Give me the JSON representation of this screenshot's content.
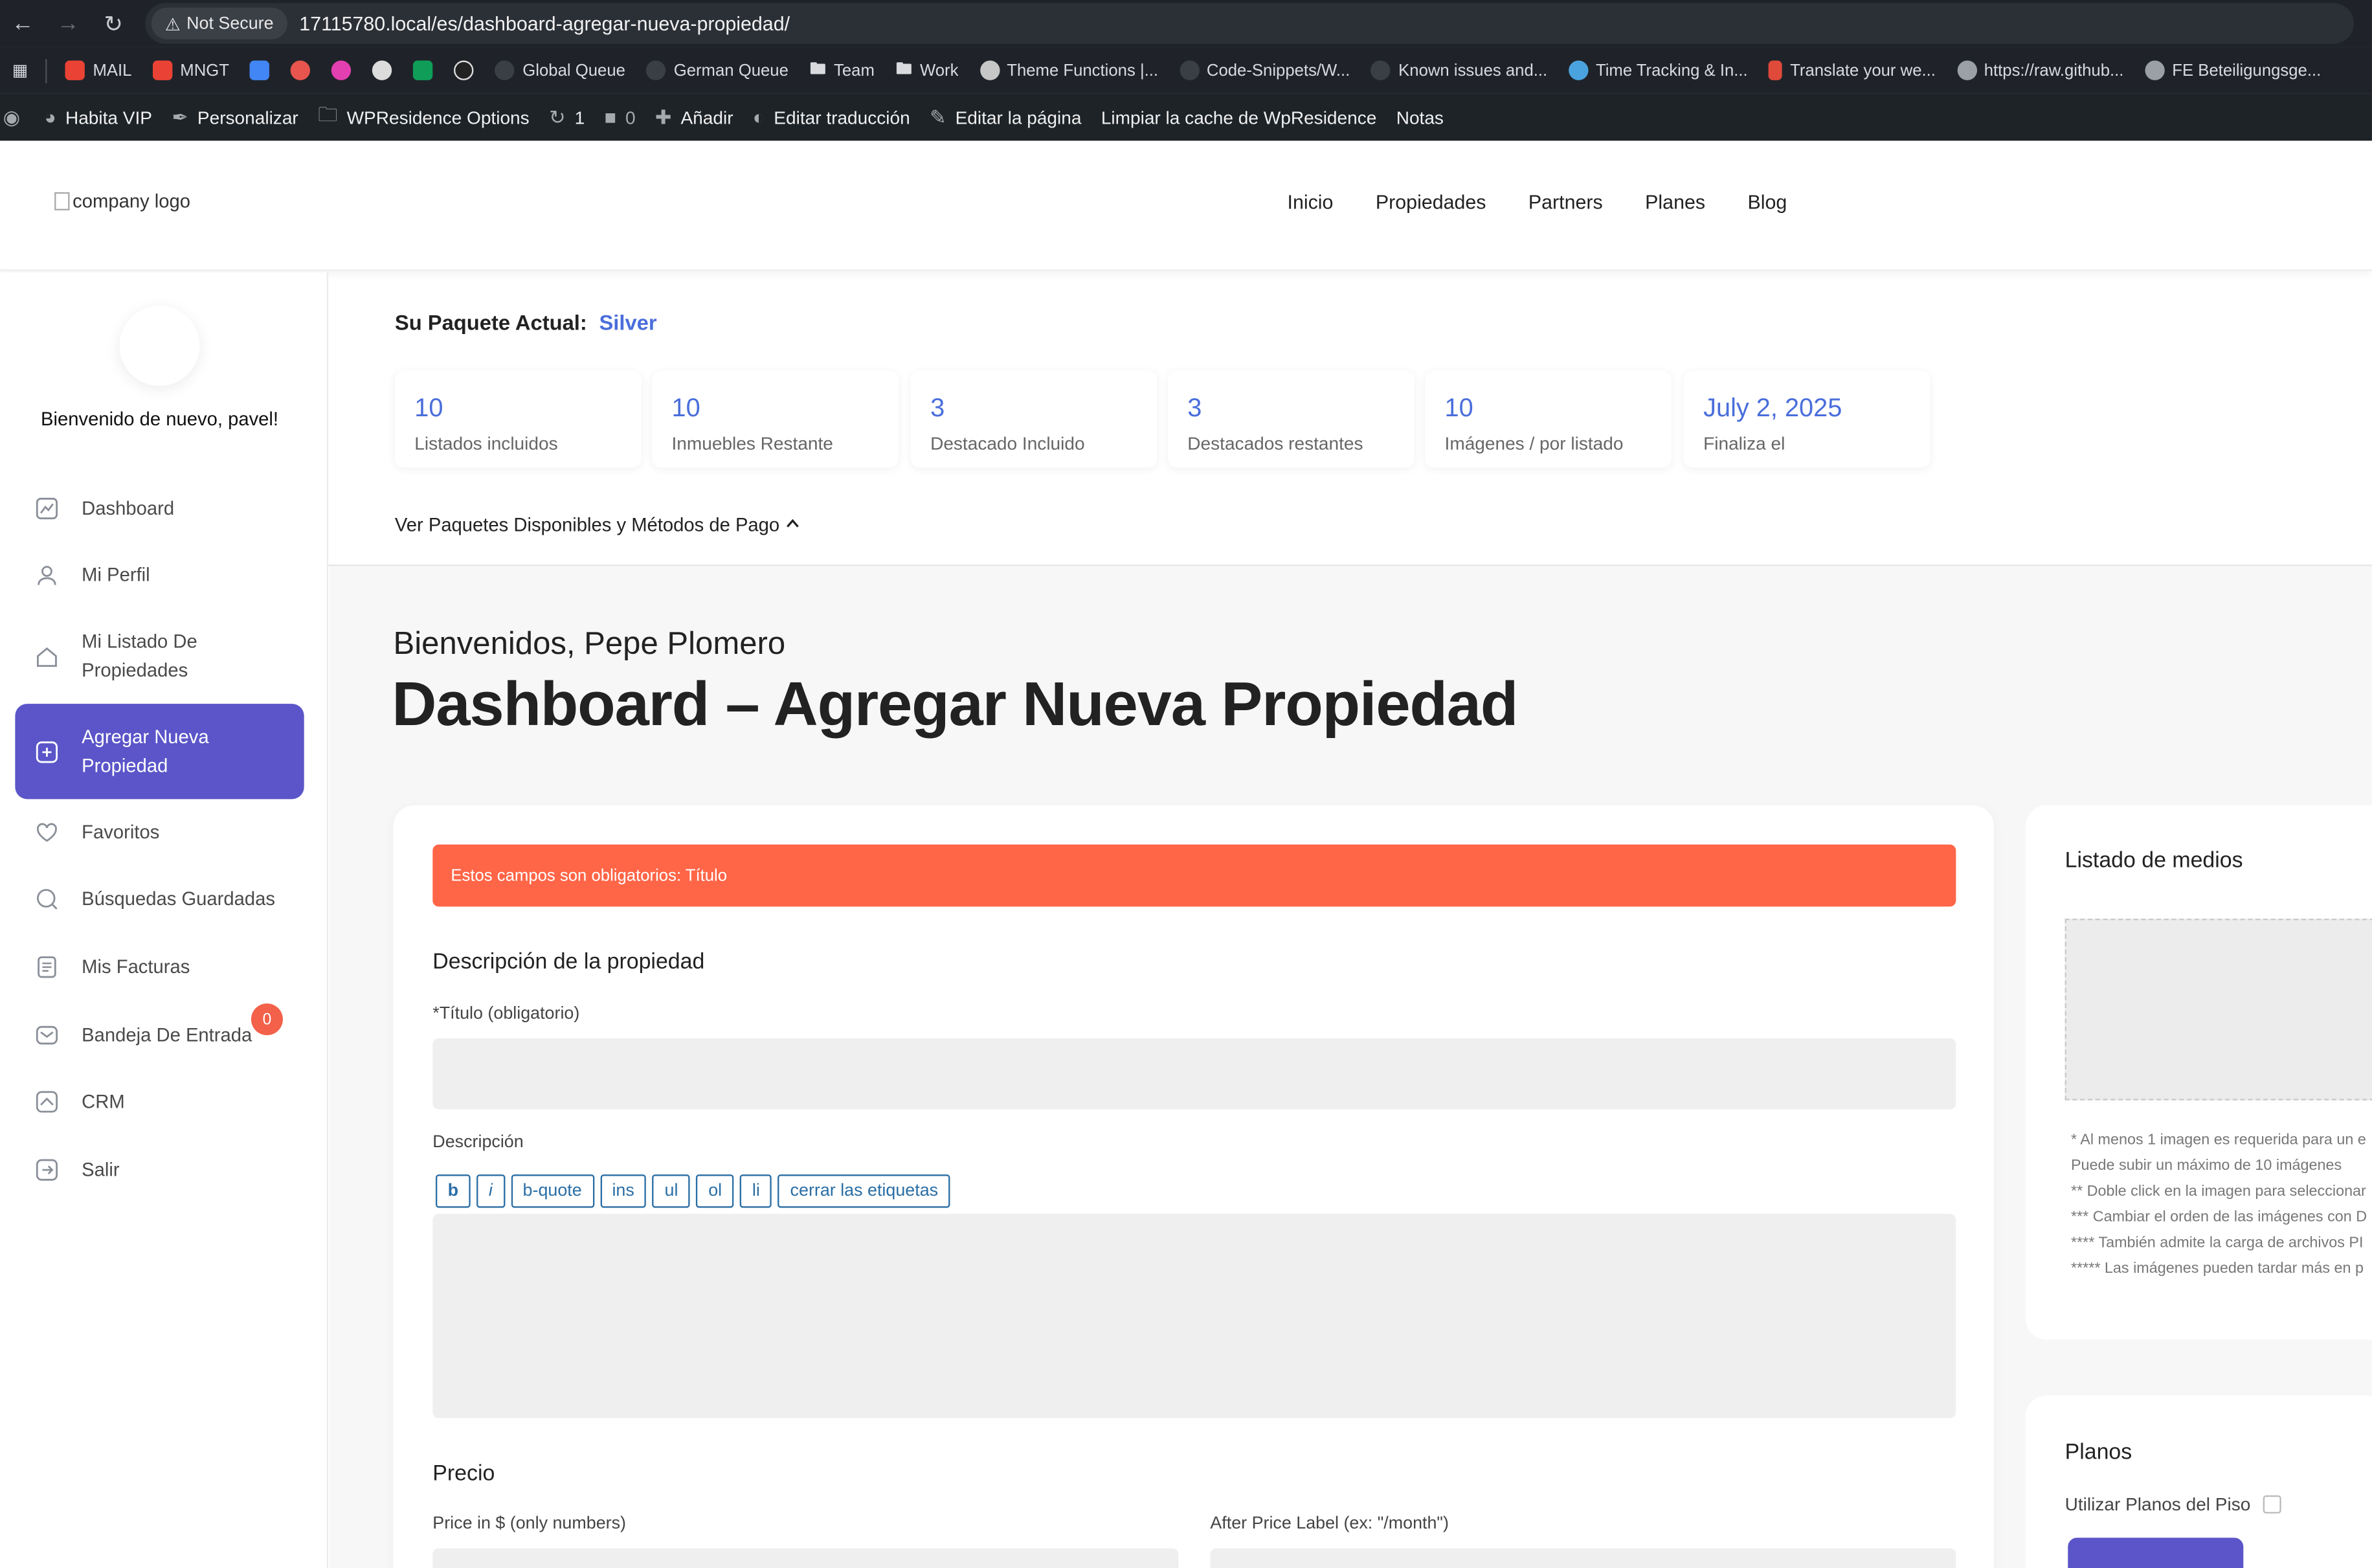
{
  "browser": {
    "security_label": "Not Secure",
    "url": "17115780.local/es/dashboard-agregar-nueva-propiedad/",
    "bookmarks": [
      "MAIL",
      "MNGT",
      "Global Queue",
      "German Queue",
      "Team",
      "Work",
      "Theme Functions |...",
      "Code-Snippets/W...",
      "Known issues and...",
      "Time Tracking & In...",
      "Translate your we...",
      "https://raw.github...",
      "FE Beteiligungsge..."
    ]
  },
  "adminbar": {
    "site": "Habita VIP",
    "customize": "Personalizar",
    "options": "WPResidence Options",
    "updates": "1",
    "comments": "0",
    "add": "Añadir",
    "edit_translation": "Editar traducción",
    "edit_page": "Editar la página",
    "clear_cache": "Limpiar la cache de WpResidence",
    "notes": "Notas"
  },
  "header": {
    "logo_alt": "company logo",
    "nav": [
      "Inicio",
      "Propiedades",
      "Partners",
      "Planes",
      "Blog"
    ]
  },
  "sidebar": {
    "welcome": "Bienvenido de nuevo, pavel!",
    "items": [
      {
        "label": "Dashboard",
        "icon": "chart-icon"
      },
      {
        "label": "Mi Perfil",
        "icon": "user-icon"
      },
      {
        "label": "Mi Listado De Propiedades",
        "icon": "home-icon"
      },
      {
        "label": "Agregar Nueva Propiedad",
        "icon": "plus-square-icon"
      },
      {
        "label": "Favoritos",
        "icon": "heart-icon"
      },
      {
        "label": "Búsquedas Guardadas",
        "icon": "search-icon"
      },
      {
        "label": "Mis Facturas",
        "icon": "invoice-icon"
      },
      {
        "label": "Bandeja De Entrada",
        "icon": "mail-icon",
        "badge": "0"
      },
      {
        "label": "CRM",
        "icon": "crm-icon"
      },
      {
        "label": "Salir",
        "icon": "logout-icon"
      }
    ]
  },
  "package": {
    "title": "Su Paquete Actual:",
    "name": "Silver",
    "stats": [
      {
        "value": "10",
        "label": "Listados incluidos"
      },
      {
        "value": "10",
        "label": "Inmuebles Restante"
      },
      {
        "value": "3",
        "label": "Destacado Incluido"
      },
      {
        "value": "3",
        "label": "Destacados restantes"
      },
      {
        "value": "10",
        "label": "Imágenes / por listado"
      },
      {
        "value": "July 2, 2025",
        "label": "Finaliza el"
      }
    ],
    "toggle": "Ver Paquetes Disponibles y Métodos de Pago"
  },
  "main": {
    "welcome": "Bienvenidos, Pepe Plomero",
    "title": "Dashboard – Agregar Nueva Propiedad"
  },
  "form": {
    "alert": "Estos campos son obligatorios: Título",
    "section_description": "Descripción de la propiedad",
    "title_label": "*Título (obligatorio)",
    "description_label": "Descripción",
    "quicktags": [
      "b",
      "i",
      "b-quote",
      "ins",
      "ul",
      "ol",
      "li",
      "cerrar las etiquetas"
    ],
    "section_price": "Precio",
    "price_label": "Price in $ (only numbers)",
    "after_price_label": "After Price Label (ex: \"/month\")"
  },
  "media": {
    "title": "Listado de medios",
    "notes": [
      "* Al menos 1 imagen es requerida para un e",
      "Puede subir un máximo de 10 imágenes",
      "** Doble click en la imagen para seleccionar",
      "*** Cambiar el orden de las imágenes con D",
      "**** También admite la carga de archivos PI",
      "***** Las imágenes pueden tardar más en p"
    ]
  },
  "plans": {
    "title": "Planos",
    "use_label": "Utilizar Planos del Piso"
  },
  "colors": {
    "accent": "#5b55c9",
    "link_blue": "#4a6edb",
    "alert": "#ff6547",
    "badge": "#f4614a"
  }
}
